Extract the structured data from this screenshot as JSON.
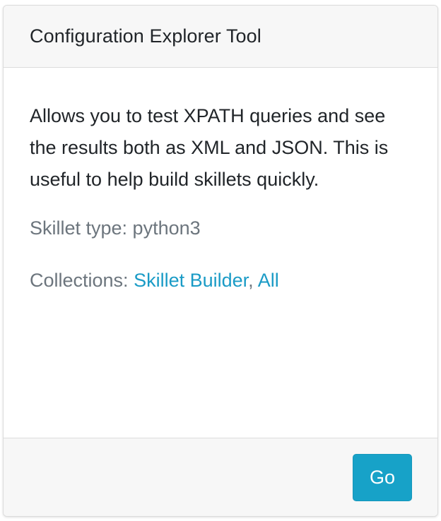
{
  "card": {
    "title": "Configuration Explorer Tool",
    "description": "Allows you to test XPATH queries and see the results both as XML and JSON. This is useful to help build skillets quickly.",
    "skillet_type_label": "Skillet type: python3",
    "collections_label": "Collections: ",
    "collections": [
      {
        "label": "Skillet Builder"
      },
      {
        "label": "All"
      }
    ],
    "collections_separator": ", ",
    "go_label": "Go"
  },
  "colors": {
    "link": "#1a9bc6",
    "button": "#17a2c8",
    "muted_text": "#6c757d",
    "header_bg": "#f7f7f7"
  }
}
